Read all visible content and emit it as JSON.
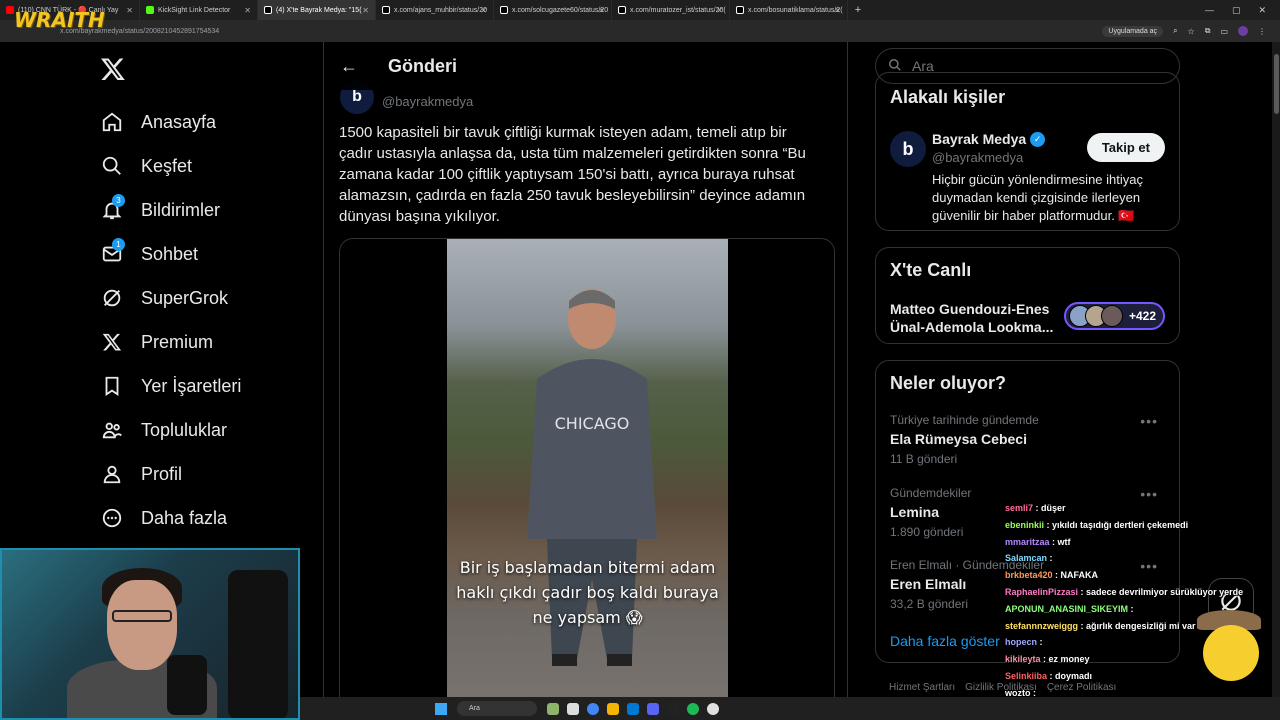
{
  "browser": {
    "tabs": [
      {
        "label": "(110) CNN TÜRK - 🔴 Canlı Yay",
        "color": "#ff0000",
        "active": false
      },
      {
        "label": "KickSight Link Detector",
        "color": "#53fc18",
        "active": false
      },
      {
        "label": "(4) X'te Bayrak Medya: \"15(",
        "color": "#ffffff",
        "active": true
      },
      {
        "label": "x.com/ajans_muhbir/status/20",
        "color": "#ffffff",
        "active": false
      },
      {
        "label": "x.com/solcugazete60/status/20",
        "color": "#ffffff",
        "active": false
      },
      {
        "label": "x.com/muratozer_ist/status/20(",
        "color": "#ffffff",
        "active": false
      },
      {
        "label": "x.com/bosunatiklama/status/2(",
        "color": "#ffffff",
        "active": false
      }
    ],
    "url": "x.com/bayrakmedya/status/2008210452891754534",
    "open_in_app": "Uygulamada aç"
  },
  "overlay_logo": "WRAITH",
  "sidebar": {
    "items": [
      {
        "label": "Anasayfa",
        "icon": "home-icon",
        "badge": ""
      },
      {
        "label": "Keşfet",
        "icon": "search-icon",
        "badge": ""
      },
      {
        "label": "Bildirimler",
        "icon": "bell-icon",
        "badge": "3"
      },
      {
        "label": "Sohbet",
        "icon": "mail-icon",
        "badge": "1"
      },
      {
        "label": "SuperGrok",
        "icon": "grok-icon",
        "badge": ""
      },
      {
        "label": "Premium",
        "icon": "x-icon",
        "badge": ""
      },
      {
        "label": "Yer İşaretleri",
        "icon": "bookmark-icon",
        "badge": ""
      },
      {
        "label": "Topluluklar",
        "icon": "communities-icon",
        "badge": ""
      },
      {
        "label": "Profil",
        "icon": "profile-icon",
        "badge": ""
      },
      {
        "label": "Daha fazla",
        "icon": "more-icon",
        "badge": ""
      }
    ]
  },
  "post": {
    "header": "Gönderi",
    "handle": "@bayrakmedya",
    "text": "1500 kapasiteli bir tavuk çiftliği kurmak isteyen adam, temeli atıp bir çadır ustasıyla anlaşsa da, usta tüm malzemeleri getirdikten sonra “Bu zamana kadar 100 çiftlik yaptıysam 150'si battı, ayrıca buraya ruhsat alamazsın, çadırda en fazla 250 tavuk besleyebilirsin” deyince adamın dünyası başına yıkılıyor.",
    "video_shirt": "CHICAGO",
    "video_caption": "Bir iş başlamadan bitermi adam haklı çıkdı çadır boş kaldı buraya ne yapsam 😱",
    "video_progress": 0.01
  },
  "search": {
    "placeholder": "Ara"
  },
  "related": {
    "title": "Alakalı kişiler",
    "name": "Bayrak Medya",
    "handle": "@bayrakmedya",
    "follow": "Takip et",
    "bio": "Hiçbir gücün yönlendirmesine ihtiyaç duymadan kendi çizgisinde ilerleyen güvenilir bir haber platformudur. 🇹🇷"
  },
  "live": {
    "title": "X'te Canlı",
    "name": "Matteo Guendouzi-Enes Ünal-Ademola Lookma...",
    "count": "+422"
  },
  "trends": {
    "title": "Neler oluyor?",
    "items": [
      {
        "meta": "Türkiye tarihinde gündemde",
        "name": "Ela Rümeysa Cebeci",
        "count": "11 B gönderi"
      },
      {
        "meta": "Gündemdekiler",
        "name": "Lemina",
        "count": "1.890 gönderi"
      },
      {
        "meta": "Eren Elmalı · Gündemdekiler",
        "name": "Eren Elmalı",
        "count": "33,2 B gönderi"
      }
    ],
    "show_more": "Daha fazla göster"
  },
  "footer": [
    "Hizmet Şartları",
    "Gizlilik Politikası",
    "Çerez Politikası"
  ],
  "chat": [
    {
      "user": "semli7",
      "msg": ": düşer",
      "color": "#ff6b9d"
    },
    {
      "user": "ebeninkii",
      "msg": ": yıkıldı taşıdığı dertleri çekemedi",
      "color": "#9cff57"
    },
    {
      "user": "mmaritzaa",
      "msg": ": wtf",
      "color": "#b388ff"
    },
    {
      "user": "Salamcan",
      "msg": ":",
      "color": "#7fdcff"
    },
    {
      "user": "brkbeta420",
      "msg": ": NAFAKA",
      "color": "#ff9a5a"
    },
    {
      "user": "RaphaelinPizzasi",
      "msg": ": sadece devrilmiyor sürüklüyor yerde",
      "color": "#ff7ac6"
    },
    {
      "user": "APONUN_ANASINI_SIKEYIM",
      "msg": ":",
      "color": "#8cff7a"
    },
    {
      "user": "stefannnzweiggg",
      "msg": ": ağırlık dengesizliği mi var",
      "color": "#ffe066"
    },
    {
      "user": "hopecn",
      "msg": ":",
      "color": "#9fa8ff"
    },
    {
      "user": "kikileyta",
      "msg": ": ez money",
      "color": "#ff8fa3"
    },
    {
      "user": "Selinkiiba",
      "msg": ": doymadı",
      "color": "#ff5f5f"
    },
    {
      "user": "wozto",
      "msg": ":",
      "color": "#ffffff"
    }
  ],
  "taskbar": {
    "search": "Ara"
  },
  "colors": {
    "accent": "#1d9bf0",
    "background": "#000000",
    "border": "#2f3336"
  }
}
